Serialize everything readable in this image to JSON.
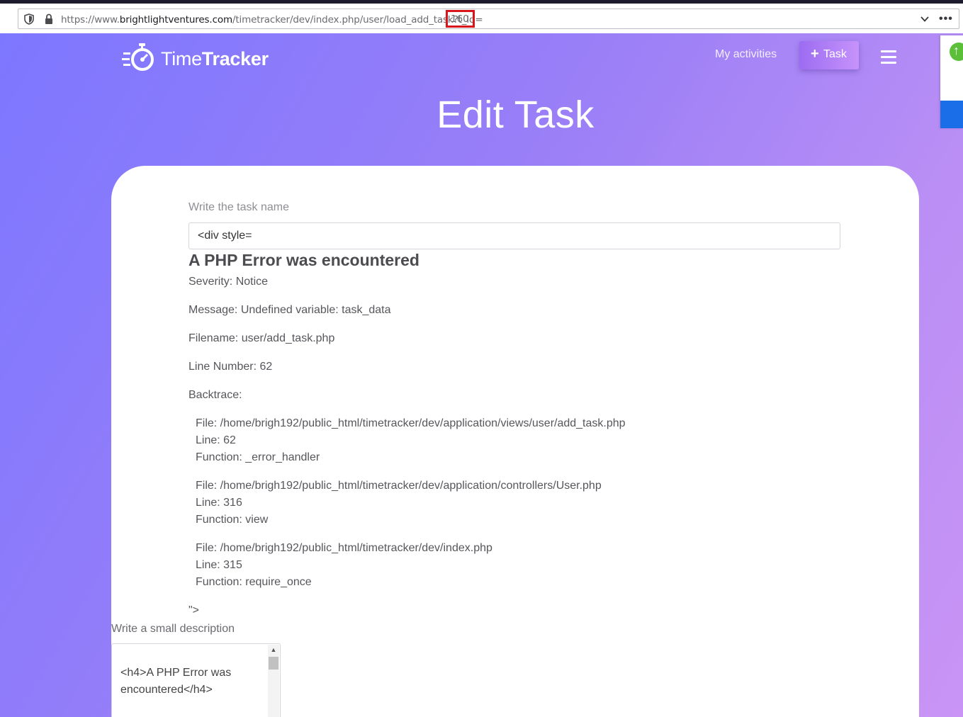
{
  "browser": {
    "url_prefix": "https://www.",
    "url_domain": "brightlightventures.com",
    "url_path": "/timetracker/dev/index.php/user/load_add_task?t_id=",
    "url_highlight": "160",
    "more_label": "•••"
  },
  "header": {
    "logo_light": "Time",
    "logo_bold": "Tracker",
    "nav_my_activities": "My activities",
    "task_button_plus": "+",
    "task_button_label": "Task"
  },
  "page": {
    "title": "Edit Task"
  },
  "form": {
    "task_name_label": "Write the task name",
    "task_name_value": "<div style=",
    "description_label": "Write a small description",
    "description_value": "<h4>A PHP Error was encountered</h4>"
  },
  "error": {
    "heading": "A PHP Error was encountered",
    "severity": "Severity: Notice",
    "message": "Message: Undefined variable: task_data",
    "filename": "Filename: user/add_task.php",
    "line_number": "Line Number: 62",
    "backtrace_label": "Backtrace:",
    "backtrace": [
      {
        "file": "File: /home/brigh192/public_html/timetracker/dev/application/views/user/add_task.php",
        "line": "Line: 62",
        "function": "Function: _error_handler"
      },
      {
        "file": "File: /home/brigh192/public_html/timetracker/dev/application/controllers/User.php",
        "line": "Line: 316",
        "function": "Function: view"
      },
      {
        "file": "File: /home/brigh192/public_html/timetracker/dev/index.php",
        "line": "Line: 315",
        "function": "Function: require_once"
      }
    ],
    "trailing": "\">"
  },
  "colors": {
    "gradient_start": "#7d77ff",
    "gradient_end": "#c994f5",
    "url_highlight_border": "#d9141b",
    "side_widget_blue": "#1a6ee8",
    "side_widget_green": "#5bbf3a"
  },
  "icons": {
    "url_shield": "shield-icon",
    "url_lock": "lock-icon",
    "url_dropdown": "chevron-down-icon",
    "url_more": "more-icon",
    "logo": "stopwatch-icon",
    "menu": "hamburger-icon",
    "side_widget": "arrow-up-icon"
  }
}
